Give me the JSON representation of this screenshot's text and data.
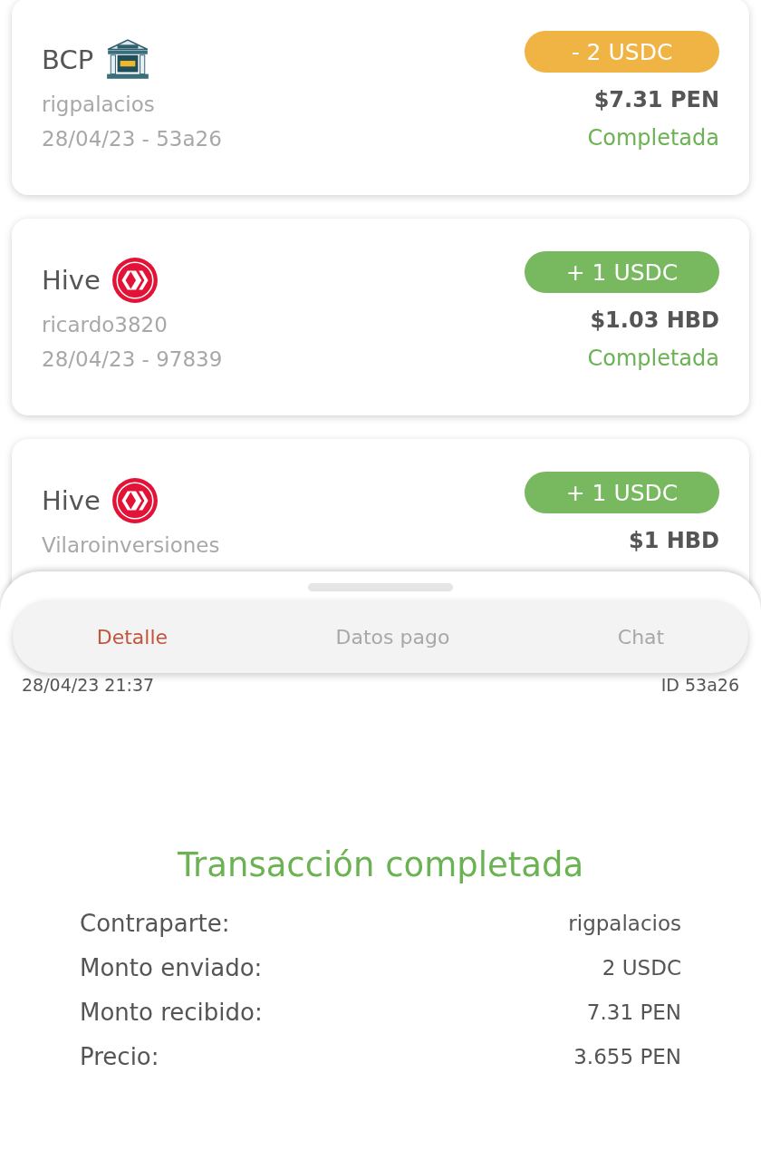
{
  "transactions": [
    {
      "name": "BCP",
      "kind": "bank",
      "user": "rigpalacios",
      "meta": "28/04/23 - 53a26",
      "badge": "- 2 USDC",
      "color": "#efb443",
      "amount": "$7.31 PEN",
      "status": "Completada"
    },
    {
      "name": "Hive",
      "kind": "hive",
      "user": "ricardo3820",
      "meta": "28/04/23 - 97839",
      "badge": "+ 1 USDC",
      "color": "#78b85f",
      "amount": "$1.03 HBD",
      "status": "Completada"
    },
    {
      "name": "Hive",
      "kind": "hive",
      "user": "Vilaroinversiones",
      "badge": "+ 1 USDC",
      "color": "#78b85f",
      "amount": "$1 HBD"
    }
  ],
  "sheet": {
    "tabs": [
      {
        "label": "Detalle",
        "selected": true
      },
      {
        "label": "Datos pago",
        "selected": false
      },
      {
        "label": "Chat",
        "selected": false
      }
    ],
    "datetime": "28/04/23  21:37",
    "id": "ID 53a26",
    "title": "Transacción completada",
    "details": [
      {
        "label": "Contraparte:",
        "value": "rigpalacios"
      },
      {
        "label": "Monto enviado:",
        "value": "2 USDC"
      },
      {
        "label": "Monto recibido:",
        "value": "7.31 PEN"
      },
      {
        "label": "Precio:",
        "value": "3.655 PEN"
      }
    ]
  }
}
